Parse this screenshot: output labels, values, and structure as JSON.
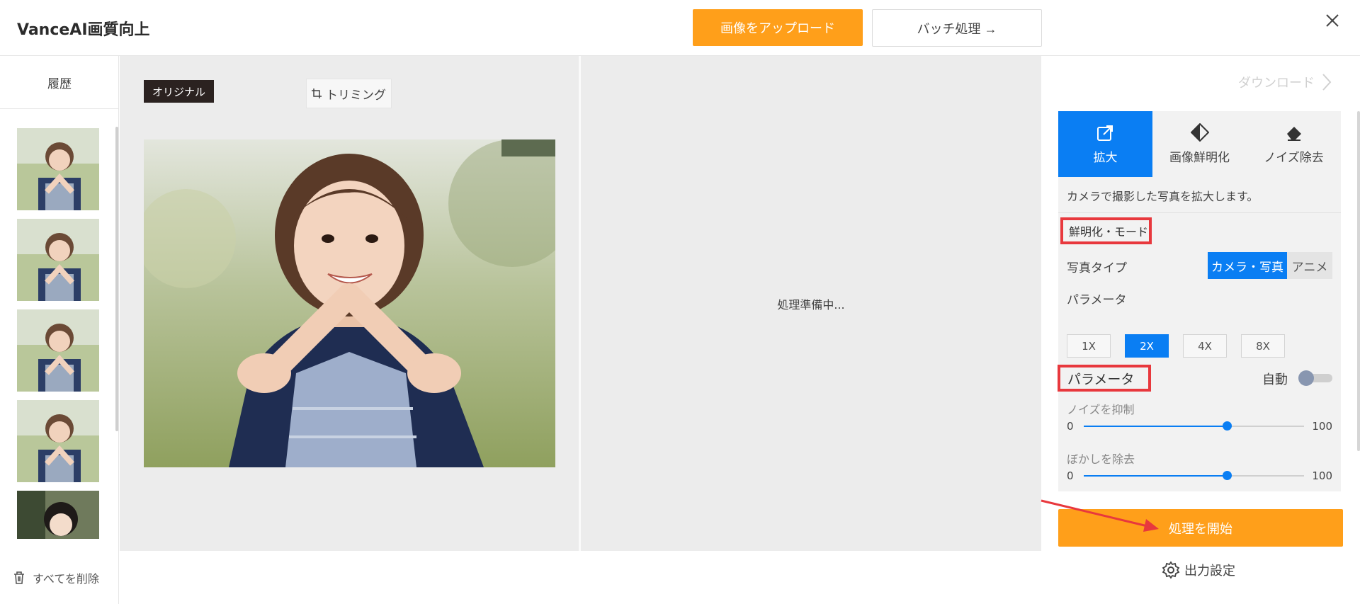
{
  "header": {
    "title": "VanceAI画質向上",
    "upload_label": "画像をアップロード",
    "batch_label": "バッチ処理 →"
  },
  "sidebar": {
    "history_label": "履歴",
    "thumbnail_count": 5,
    "delete_all_label": "すべてを削除"
  },
  "canvas": {
    "original_badge": "オリジナル",
    "trim_label": "トリミング",
    "preparing_text": "処理準備中..."
  },
  "panel": {
    "download_label": "ダウンロード",
    "tabs": [
      {
        "label": "拡大",
        "active": true
      },
      {
        "label": "画像鮮明化",
        "active": false
      },
      {
        "label": "ノイズ除去",
        "active": false
      }
    ],
    "description": "カメラで撮影した写真を拡大します。",
    "mode_label": "鮮明化・モード",
    "photo_type_label": "写真タイプ",
    "photo_type_options": [
      {
        "label": "カメラ・写真",
        "selected": true
      },
      {
        "label": "アニメ",
        "selected": false
      }
    ],
    "parameter_label": "パラメータ",
    "scales": [
      {
        "label": "1X",
        "selected": false
      },
      {
        "label": "2X",
        "selected": true
      },
      {
        "label": "4X",
        "selected": false
      },
      {
        "label": "8X",
        "selected": false
      }
    ],
    "parameter_label_2": "パラメータ",
    "auto_label": "自動",
    "auto_on": false,
    "noise": {
      "label": "ノイズを抑制",
      "min": "0",
      "max": "100",
      "value": 65
    },
    "blur": {
      "label": "ぼかしを除去",
      "min": "0",
      "max": "100",
      "value": 65
    },
    "start_label": "処理を開始",
    "output_settings_label": "出力設定"
  },
  "colors": {
    "accent_orange": "#ff9f1a",
    "accent_blue": "#0a7ef3",
    "highlight_red": "#e8383d"
  }
}
